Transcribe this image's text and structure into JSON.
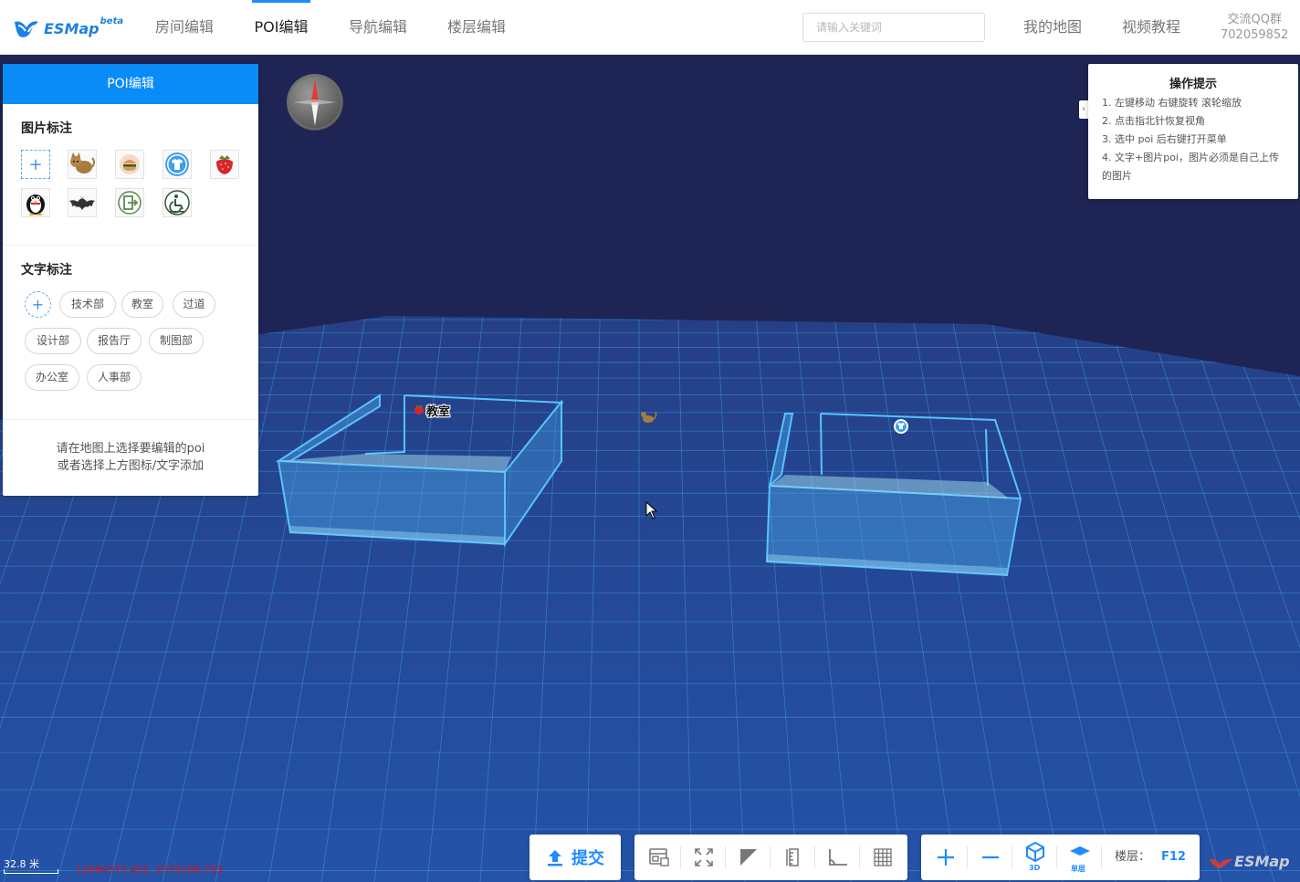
{
  "app": {
    "logo_text": "ESMap",
    "logo_beta": "beta"
  },
  "nav": {
    "tabs": [
      {
        "label": "房间编辑",
        "active": false
      },
      {
        "label": "POI编辑",
        "active": true
      },
      {
        "label": "导航编辑",
        "active": false
      },
      {
        "label": "楼层编辑",
        "active": false
      }
    ],
    "search_placeholder": "请输入关键词",
    "my_map": "我的地图",
    "video_tutorial": "视频教程",
    "qq_group_label": "交流QQ群",
    "qq_group_number": "702059852"
  },
  "panel": {
    "title": "POI编辑",
    "image_section_title": "图片标注",
    "image_icons": [
      "add-icon",
      "cat-icon",
      "burger-icon",
      "tshirt-icon",
      "strawberry-icon",
      "penguin-icon",
      "bat-icon",
      "exit-icon",
      "wheelchair-icon"
    ],
    "text_section_title": "文字标注",
    "text_tags": [
      "技术部",
      "教室",
      "过道",
      "设计部",
      "报告厅",
      "制图部",
      "办公室",
      "人事部"
    ],
    "hint_line1": "请在地图上选择要编辑的poi",
    "hint_line2": "或者选择上方图标/文字添加"
  },
  "tips": {
    "title": "操作提示",
    "items": [
      "1. 左键移动 右键旋转 滚轮缩放",
      "2. 点击指北针恢复视角",
      "3. 选中 poi 后右键打开菜单",
      "4. 文字+图片poi，图片必须是自己上传的图片"
    ],
    "toggle": "›"
  },
  "map": {
    "poi_label_classroom": "教室",
    "scale_text": "32.8 米",
    "coords_text": "12684372.452, 2575106.793",
    "watermark": "ESMap"
  },
  "toolbar": {
    "submit_label": "提交",
    "tools": [
      "layout-icon",
      "fullscreen-icon",
      "triangle-icon",
      "ruler-icon",
      "angle-icon",
      "grid-icon"
    ],
    "zoom_in": "+",
    "zoom_out": "−",
    "view_3d_label": "3D",
    "single_floor_label": "单层",
    "floor_label": "楼层：",
    "floor_value": "F12"
  },
  "colors": {
    "accent": "#0a8cf8",
    "map_bg": "#1e2453",
    "floor": "#244d9a",
    "grid": "#3fa6e8"
  }
}
